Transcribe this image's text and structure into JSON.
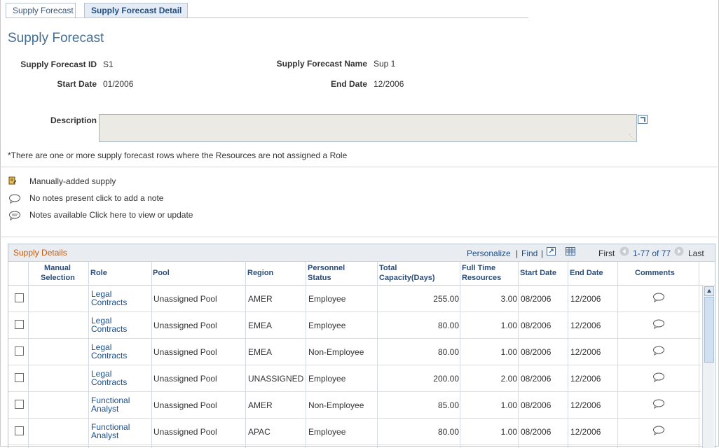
{
  "tabs": [
    {
      "label": "Supply Forecast"
    },
    {
      "label": "Supply Forecast Detail"
    }
  ],
  "page": {
    "title": "Supply Forecast"
  },
  "header": {
    "id_label": "Supply Forecast ID",
    "id_value": "S1",
    "name_label": "Supply Forecast Name",
    "name_value": "Sup 1",
    "start_label": "Start Date",
    "start_value": "01/2006",
    "end_label": "End Date",
    "end_value": "12/2006",
    "description_label": "Description",
    "description_value": ""
  },
  "note": "*There are one or more supply forecast rows where the Resources are not assigned a Role",
  "legend": [
    {
      "icon": "manual-supply-icon",
      "text": "Manually-added supply"
    },
    {
      "icon": "note-empty-icon",
      "text": "No notes present click to add a note"
    },
    {
      "icon": "note-available-icon",
      "text": "Notes available Click here to view or update"
    }
  ],
  "grid": {
    "title": "Supply Details",
    "personalize": "Personalize",
    "find": "Find",
    "first": "First",
    "range": "1-77 of 77",
    "last": "Last",
    "columns": {
      "manual": "Manual Selection",
      "role": "Role",
      "pool": "Pool",
      "region": "Region",
      "status": "Personnel Status",
      "capacity": "Total Capacity(Days)",
      "ftr": "Full Time Resources",
      "start": "Start Date",
      "end": "End Date",
      "comments": "Comments"
    },
    "rows": [
      {
        "role": "Legal Contracts",
        "pool": "Unassigned Pool",
        "region": "AMER",
        "status": "Employee",
        "capacity": "255.00",
        "ftr": "3.00",
        "start": "08/2006",
        "end": "12/2006"
      },
      {
        "role": "Legal Contracts",
        "pool": "Unassigned Pool",
        "region": "EMEA",
        "status": "Employee",
        "capacity": "80.00",
        "ftr": "1.00",
        "start": "08/2006",
        "end": "12/2006"
      },
      {
        "role": "Legal Contracts",
        "pool": "Unassigned Pool",
        "region": "EMEA",
        "status": "Non-Employee",
        "capacity": "80.00",
        "ftr": "1.00",
        "start": "08/2006",
        "end": "12/2006"
      },
      {
        "role": "Legal Contracts",
        "pool": "Unassigned Pool",
        "region": "UNASSIGNED",
        "status": "Employee",
        "capacity": "200.00",
        "ftr": "2.00",
        "start": "08/2006",
        "end": "12/2006"
      },
      {
        "role": "Functional Analyst",
        "pool": "Unassigned Pool",
        "region": "AMER",
        "status": "Non-Employee",
        "capacity": "85.00",
        "ftr": "1.00",
        "start": "08/2006",
        "end": "12/2006"
      },
      {
        "role": "Functional Analyst",
        "pool": "Unassigned Pool",
        "region": "APAC",
        "status": "Employee",
        "capacity": "80.00",
        "ftr": "1.00",
        "start": "08/2006",
        "end": "12/2006"
      }
    ]
  }
}
